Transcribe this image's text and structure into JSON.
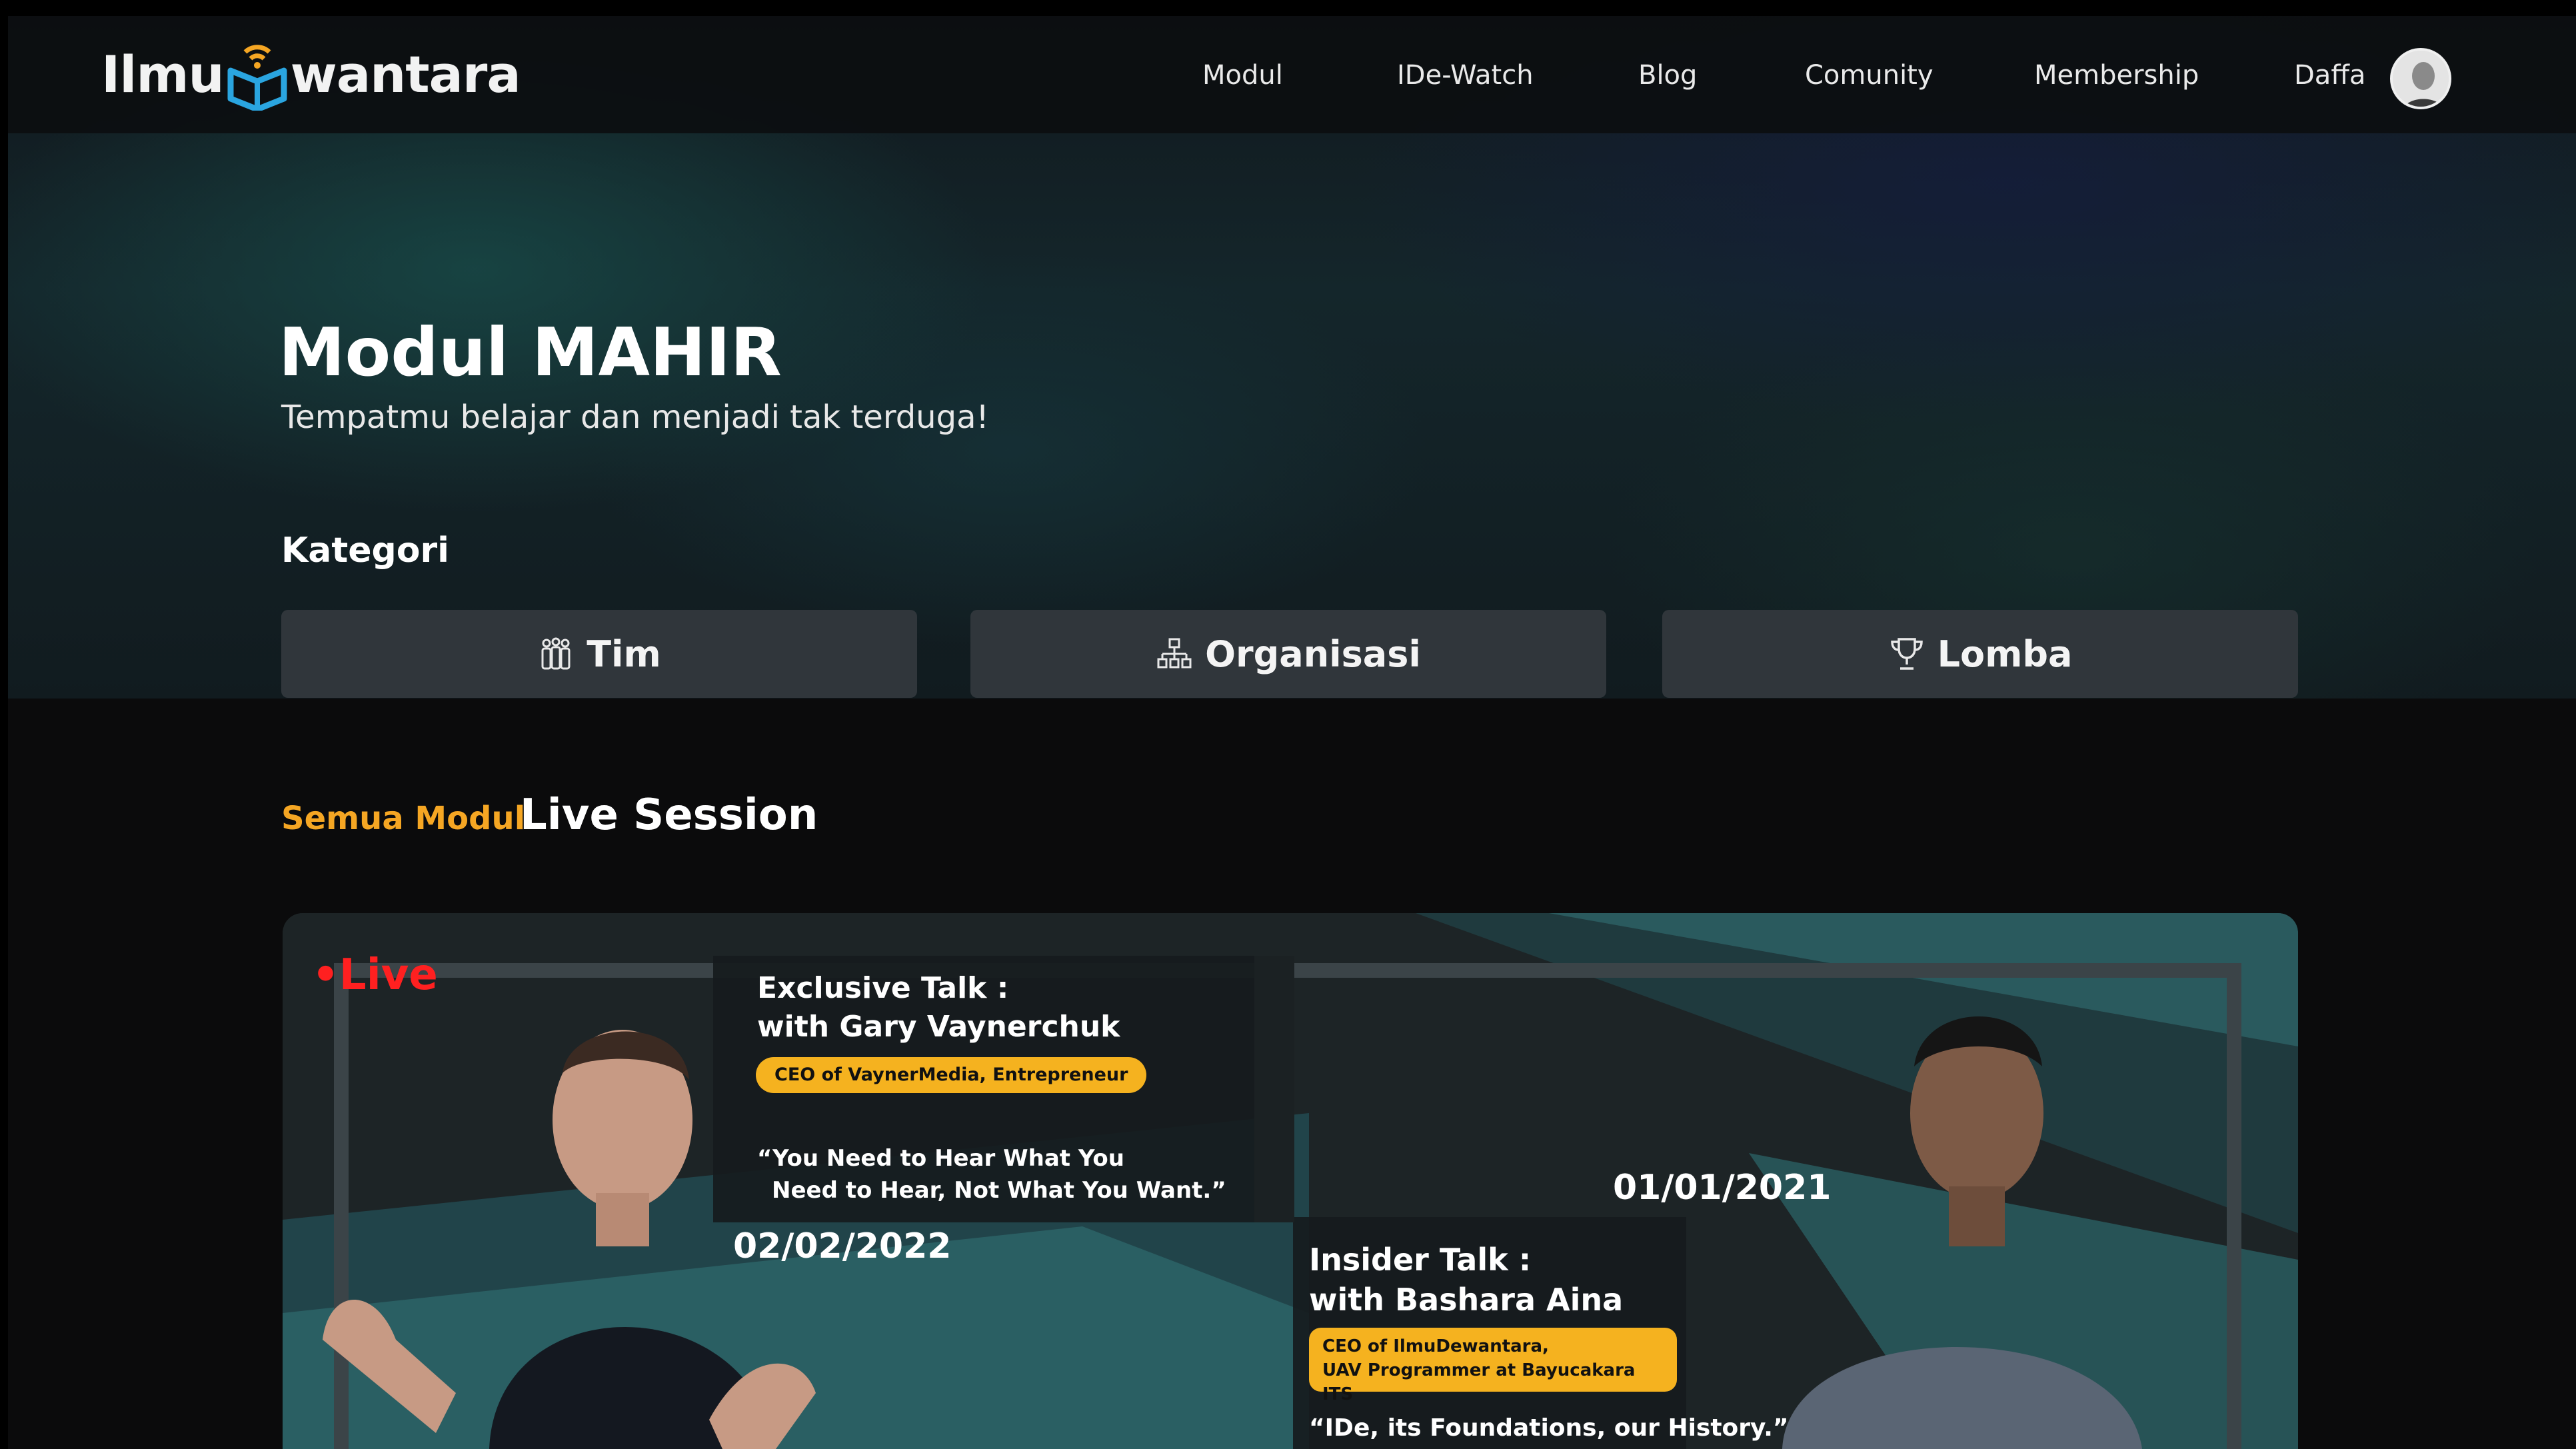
{
  "colors": {
    "accent_orange": "#f5a623",
    "live_red": "#ff2020",
    "badge_yellow": "#f5b21f",
    "category_button_bg": "#30363b"
  },
  "brand": {
    "logo_left": "Ilmu",
    "logo_right": "wantara",
    "logo_mark_icon": "book-wifi-icon"
  },
  "nav": {
    "items": [
      {
        "label": "Modul"
      },
      {
        "label": "IDe-Watch"
      },
      {
        "label": "Blog"
      },
      {
        "label": "Comunity"
      },
      {
        "label": "Membership"
      }
    ],
    "user_name": "Daffa",
    "avatar_icon": "user-avatar"
  },
  "hero": {
    "title": "Modul MAHIR",
    "subtitle": "Tempatmu belajar dan menjadi tak terduga!"
  },
  "categories": {
    "title": "Kategori",
    "items": [
      {
        "label": "Tim",
        "icon": "team-icon"
      },
      {
        "label": "Organisasi",
        "icon": "org-chart-icon"
      },
      {
        "label": "Lomba",
        "icon": "trophy-icon"
      }
    ]
  },
  "tabs": {
    "all": "Semua Modul",
    "live": "Live Session"
  },
  "banner": {
    "live_label": "•Live",
    "exclusive": {
      "title_line1": "Exclusive Talk :",
      "title_line2": "with Gary Vaynerchuk",
      "badge": "CEO of VaynerMedia, Entrepreneur",
      "quote_line1": "“You Need to Hear What You",
      "quote_line2": "Need to Hear, Not What You Want.”",
      "date": "02/02/2022"
    },
    "insider": {
      "date": "01/01/2021",
      "title_line1": "Insider Talk :",
      "title_line2": "with Bashara Aina",
      "badge_line1": "CEO of IlmuDewantara,",
      "badge_line2": "UAV Programmer at Bayucakara ITS",
      "quote": "“IDe, its Foundations, our History.”"
    }
  }
}
